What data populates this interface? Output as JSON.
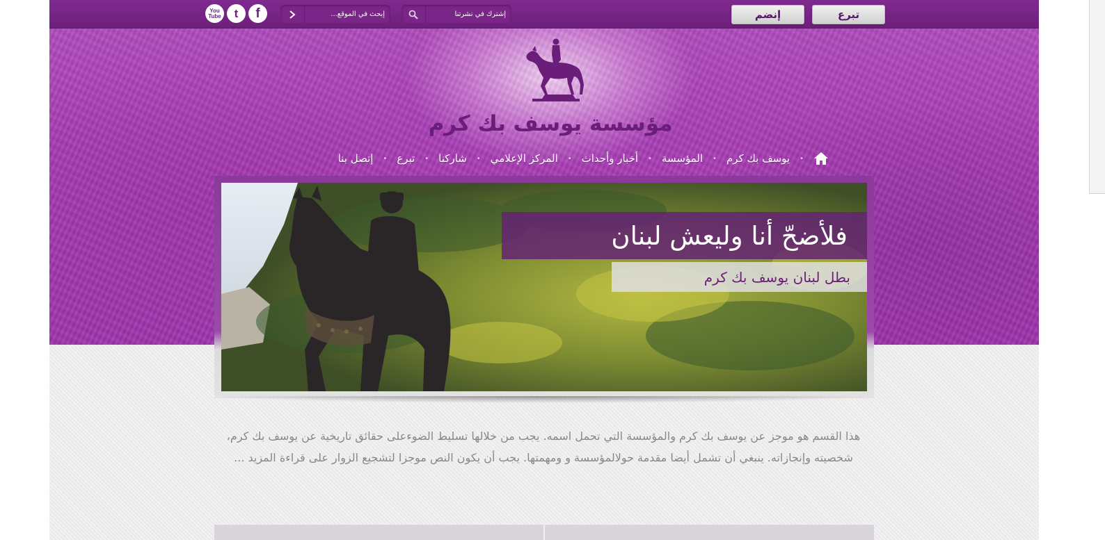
{
  "topbar": {
    "donate_label": "تبرع",
    "join_label": "إنضم",
    "newsletter_placeholder": "إشترك في نشرتنا",
    "search_placeholder": "إبحث في الموقع...",
    "social": [
      {
        "name": "youtube",
        "label": "You\nTube"
      },
      {
        "name": "twitter",
        "label": "t"
      },
      {
        "name": "facebook",
        "label": "f"
      }
    ]
  },
  "logo": {
    "title": "مؤسسة يوسف بك كرم",
    "icon": "horse-rider-statue-icon"
  },
  "nav": {
    "items": [
      {
        "label": "يوسف بك كرم"
      },
      {
        "label": "المؤسسة"
      },
      {
        "label": "أخبار وأحداث"
      },
      {
        "label": "المركز الإعلامي"
      },
      {
        "label": "شاركنا"
      },
      {
        "label": "تبرع"
      },
      {
        "label": "إتصل بنا"
      }
    ]
  },
  "slider": {
    "caption_title": "فلأضحّ أنا وليعش لبنان",
    "caption_subtitle": "بطل لبنان يوسف بك كرم"
  },
  "intro": {
    "text": "هذا القسم هو موجز عن يوسف بك كرم والمؤسسة التي تحمل اسمه. يجب من خلالها تسليط الضوءعلى حقائق تاريخية عن يوسف بك كرم، شخصيته وإنجازاته. ينبغي أن تشمل أيضا مقدمة حولالمؤسسة و ومهمتها. يجب أن يكون النص موجزا لتشجيع الزوار على قراءة المزيد ..."
  },
  "colors": {
    "brand_purple": "#6d1f7d",
    "hero_purple": "#a93fb6",
    "caption_purple": "#64237"
  }
}
